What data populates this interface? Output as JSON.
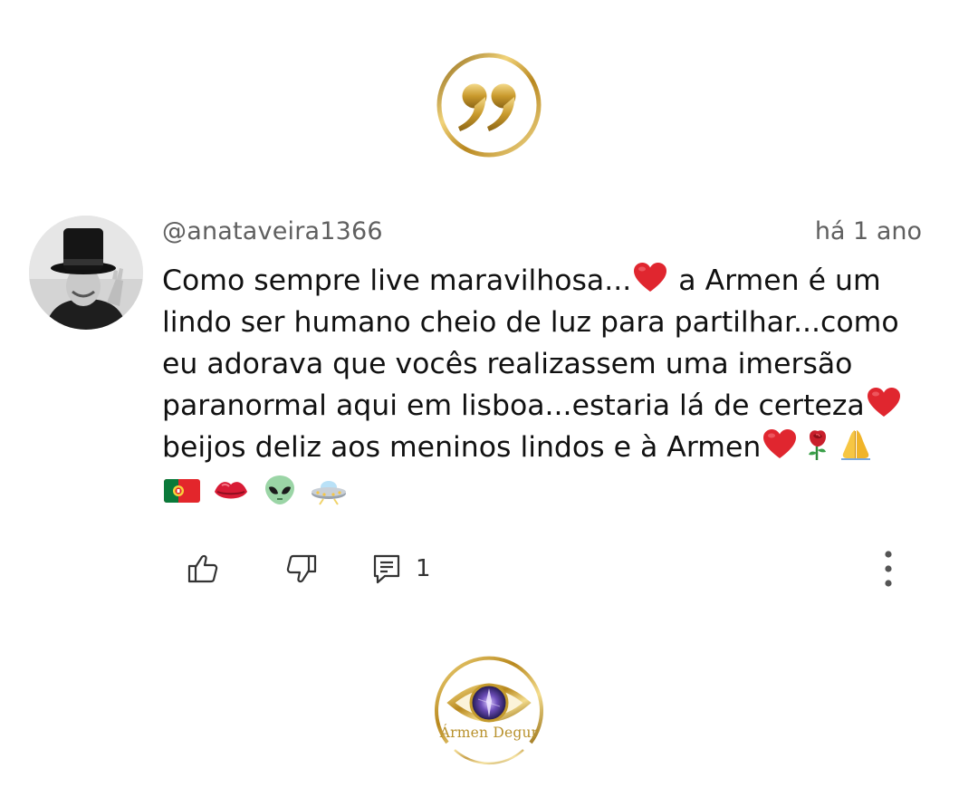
{
  "comment": {
    "handle": "@anataveira1366",
    "timestamp": "há 1 ano",
    "lines": [
      {
        "text": "Como sempre  live maravilhosa...",
        "after": "a Armen é  um"
      },
      {
        "text": "lindo ser humano cheio de luz para partilhar...como"
      },
      {
        "text": "eu adorava que vocês realizassem uma imersão"
      },
      {
        "text": "paranormal aqui em lisboa...estaria lá  de certeza"
      },
      {
        "text": "beijos deliz aos meninos lindos e à  Armen"
      }
    ],
    "emojis_line5": [
      "red-heart",
      "rose",
      "folded-hands"
    ],
    "emojis_line6": [
      "portugal-flag",
      "kiss-mark",
      "alien",
      "flying-saucer"
    ],
    "actions": {
      "reply_count": "1"
    }
  },
  "brand": {
    "name": "Ármen Degur"
  },
  "colors": {
    "gold": "#c9a13b",
    "heart": "#e0262f",
    "text": "#111111",
    "muted": "#606060"
  }
}
